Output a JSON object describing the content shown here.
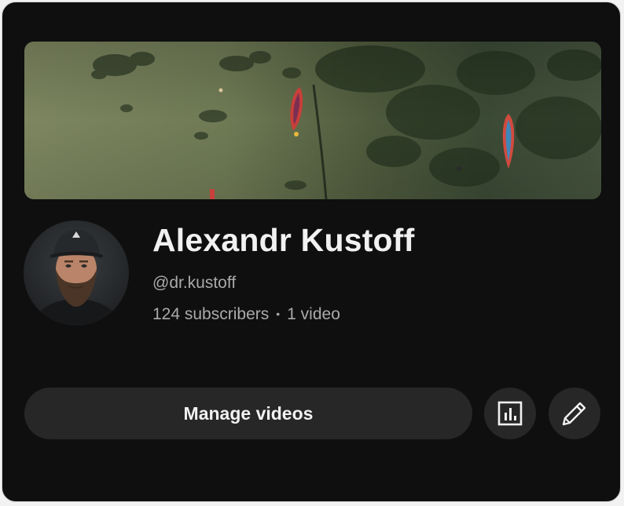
{
  "channel": {
    "name": "Alexandr Kustoff",
    "handle": "@dr.kustoff",
    "subscribers": "124 subscribers",
    "separator": "•",
    "videos": "1 video"
  },
  "actions": {
    "manage_label": "Manage videos",
    "analytics_icon": "analytics-icon",
    "edit_icon": "pencil-icon"
  },
  "colors": {
    "background": "#0f0f0f",
    "button": "#272727",
    "text_primary": "#f1f1f1",
    "text_secondary": "#aaaaaa"
  }
}
